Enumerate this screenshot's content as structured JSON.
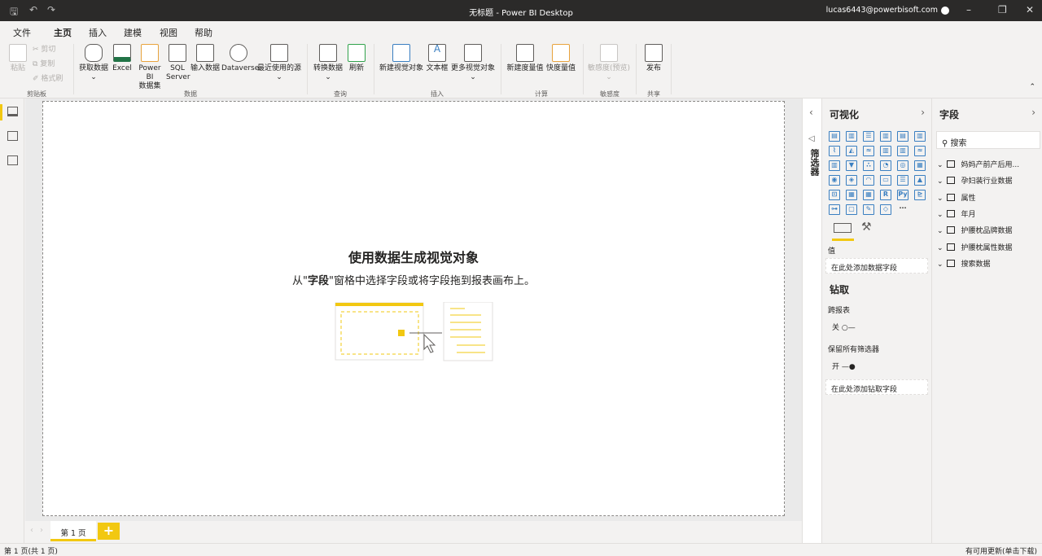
{
  "title": "无标题 - Power BI Desktop",
  "user": "lucas6443@powerbisoft.com",
  "menu_tabs": [
    "文件",
    "主页",
    "插入",
    "建模",
    "视图",
    "帮助"
  ],
  "ribbon": {
    "clipboard": {
      "paste": "粘贴",
      "cut": "剪切",
      "copy": "复制",
      "format": "格式刷",
      "group": "剪贴板"
    },
    "data": {
      "get": "获取数据",
      "excel": "Excel",
      "pbi1": "Power BI",
      "pbi2": "数据集",
      "sql1": "SQL",
      "sql2": "Server",
      "enter": "输入数据",
      "dataverse": "Dataverse",
      "recent": "最近使用的源",
      "group": "数据"
    },
    "query": {
      "transform": "转换数据",
      "refresh": "刷新",
      "group": "查询"
    },
    "insert": {
      "newvisual": "新建视觉对象",
      "textbox": "文本框",
      "more": "更多视觉对象",
      "group": "插入"
    },
    "calc": {
      "measure": "新建度量值",
      "quick": "快度量值",
      "group": "计算"
    },
    "sensitivity": {
      "label": "敏感度(预览)",
      "group": "敏感度"
    },
    "share": {
      "publish": "发布",
      "group": "共享"
    }
  },
  "canvas": {
    "title": "使用数据生成视觉对象",
    "sub_pre": "从\"",
    "sub_bold": "字段",
    "sub_post": "\"窗格中选择字段或将字段拖到报表画布上。"
  },
  "pages": {
    "tab": "第 1 页",
    "add": "+"
  },
  "status": {
    "left": "第 1 页(共 1 页)",
    "right": "有可用更新(单击下载)"
  },
  "filters": {
    "label": "筛选器"
  },
  "viz": {
    "title": "可视化",
    "values_label": "值",
    "values_well": "在此处添加数据字段",
    "drill_title": "钻取",
    "cross_report": "跨报表",
    "cross_state": "关",
    "keep_filters": "保留所有筛选器",
    "keep_state": "开",
    "drill_well": "在此处添加钻取字段",
    "icons": [
      "stacked-bar",
      "stacked-column",
      "clustered-bar",
      "clustered-column",
      "100-bar",
      "100-column",
      "line",
      "area",
      "stacked-area",
      "line-column",
      "line-clustered",
      "ribbon",
      "waterfall",
      "funnel",
      "scatter",
      "pie",
      "donut",
      "treemap",
      "map",
      "filled-map",
      "gauge",
      "card",
      "multirow-card",
      "kpi",
      "slicer",
      "table",
      "matrix",
      "r-visual",
      "python-visual",
      "key-influencers",
      "decomposition-tree",
      "qa",
      "smart-narrative",
      "paginated",
      "more"
    ],
    "glyphs": [
      "▤",
      "▥",
      "☰",
      "▥",
      "▤",
      "▥",
      "⌇",
      "◭",
      "≈",
      "▥",
      "▥",
      "≈",
      "▥",
      "▼",
      "∴",
      "◔",
      "◎",
      "▦",
      "◉",
      "◈",
      "◠",
      "▭",
      "☰",
      "▲",
      "⊡",
      "▦",
      "▦",
      "R",
      "Py",
      "⊵",
      "⊶",
      "▢",
      "✎",
      "◇",
      "···"
    ]
  },
  "fields": {
    "title": "字段",
    "search_placeholder": "搜索",
    "tables": [
      "妈妈产前产后用...",
      "孕妇装行业数据",
      "属性",
      "年月",
      "护腰枕品牌数据",
      "护腰枕属性数据",
      "搜索数据"
    ]
  }
}
